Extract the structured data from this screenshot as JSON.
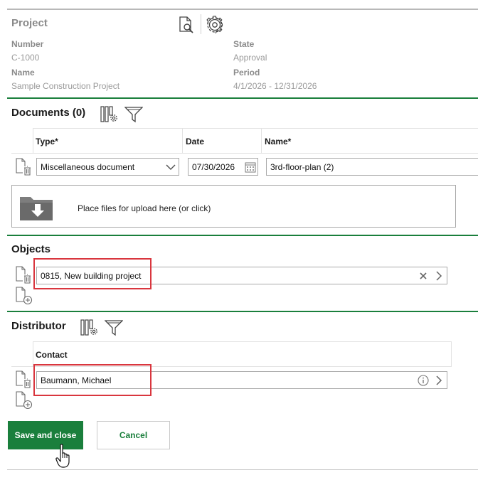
{
  "project": {
    "title": "Project",
    "number_label": "Number",
    "number_value": "C-1000",
    "name_label": "Name",
    "name_value": "Sample Construction Project",
    "state_label": "State",
    "state_value": "Approval",
    "period_label": "Period",
    "period_value": "4/1/2026 - 12/31/2026"
  },
  "documents": {
    "title": "Documents (0)",
    "columns": [
      "Type*",
      "Date",
      "Name*"
    ],
    "row": {
      "type": "Miscellaneous document",
      "date": "07/30/2026",
      "name": "3rd-floor-plan (2)"
    },
    "drop_zone": "Place files for upload here (or click)"
  },
  "objects": {
    "title": "Objects",
    "value": "0815, New building project"
  },
  "distributor": {
    "title": "Distributor",
    "column": "Contact",
    "value": "Baumann, Michael"
  },
  "actions": {
    "save": "Save and close",
    "cancel": "Cancel"
  },
  "colors": {
    "accent": "#1a7f3c",
    "highlight": "#d9363e"
  }
}
